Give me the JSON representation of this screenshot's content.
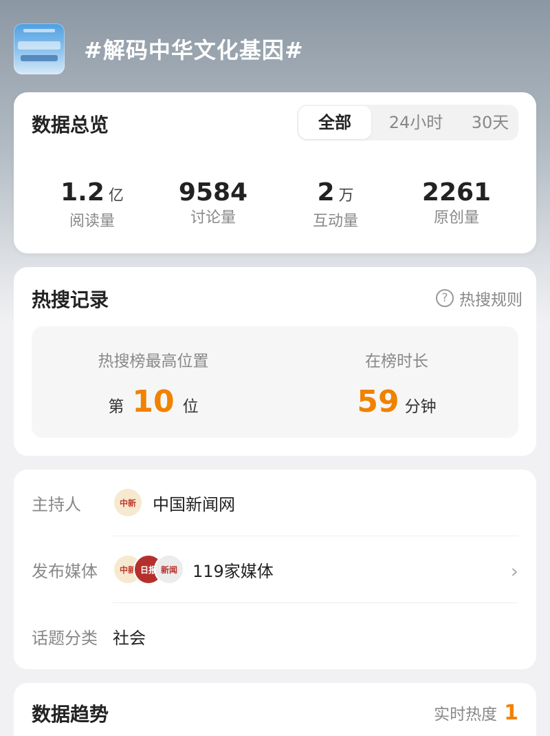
{
  "topic": {
    "title": "#解码中华文化基因#"
  },
  "overview": {
    "title": "数据总览",
    "tabs": [
      "全部",
      "24小时",
      "30天"
    ],
    "active_tab": "全部",
    "stats": [
      {
        "value": "1.2",
        "unit": "亿",
        "label": "阅读量"
      },
      {
        "value": "9584",
        "unit": "",
        "label": "讨论量"
      },
      {
        "value": "2",
        "unit": "万",
        "label": "互动量"
      },
      {
        "value": "2261",
        "unit": "",
        "label": "原创量"
      }
    ]
  },
  "hot_search": {
    "title": "热搜记录",
    "rules_label": "热搜规则",
    "highest_label": "热搜榜最高位置",
    "highest_prefix": "第",
    "highest_value": "10",
    "highest_suffix": "位",
    "duration_label": "在榜时长",
    "duration_value": "59",
    "duration_unit": "分钟"
  },
  "info": {
    "host_label": "主持人",
    "host_name": "中国新闻网",
    "media_label": "发布媒体",
    "media_count": "119家媒体",
    "category_label": "话题分类",
    "category_value": "社会"
  },
  "trend": {
    "title": "数据趋势",
    "heat_label": "实时热度",
    "heat_value": "1"
  },
  "colors": {
    "accent": "#f08200",
    "muted": "#888888",
    "card": "#ffffff"
  }
}
